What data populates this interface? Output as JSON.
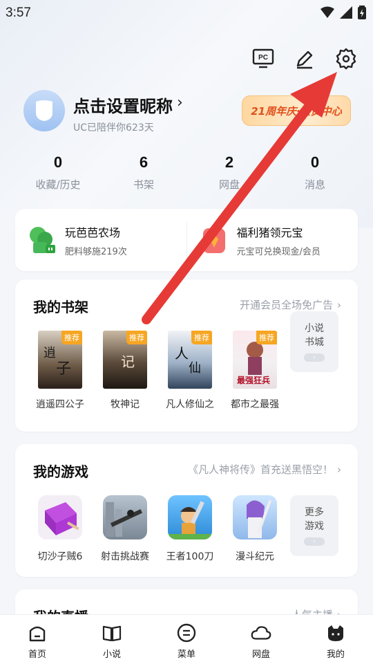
{
  "status": {
    "time": "3:57"
  },
  "profile": {
    "nickname": "点击设置昵称",
    "subline": "UC已陪伴你623天",
    "anniversary": "21周年庆·会员中心"
  },
  "stats": [
    {
      "value": "0",
      "label": "收藏/历史"
    },
    {
      "value": "6",
      "label": "书架"
    },
    {
      "value": "2",
      "label": "网盘"
    },
    {
      "value": "0",
      "label": "消息"
    }
  ],
  "promos": [
    {
      "title": "玩芭芭农场",
      "sub": "肥料够施219次",
      "icon": "farm-tree-icon"
    },
    {
      "title": "福利猪领元宝",
      "sub": "元宝可兑换现金/会员",
      "icon": "lucky-pig-icon"
    }
  ],
  "shelf": {
    "title": "我的书架",
    "link": "开通会员全场免广告",
    "badge": "推荐",
    "books": [
      {
        "title": "逍遥四公子"
      },
      {
        "title": "牧神记"
      },
      {
        "title": "凡人修仙之"
      },
      {
        "title": "都市之最强"
      }
    ],
    "more": {
      "line1": "小说",
      "line2": "书城"
    }
  },
  "games": {
    "title": "我的游戏",
    "link": "《凡人神将传》首充送黑悟空！",
    "items": [
      {
        "title": "切沙子贼6"
      },
      {
        "title": "射击挑战赛"
      },
      {
        "title": "王者100刀"
      },
      {
        "title": "漫斗纪元"
      }
    ],
    "more": {
      "line1": "更多",
      "line2": "游戏"
    }
  },
  "live": {
    "title": "我的直播",
    "link": "人气主播"
  },
  "nav": [
    {
      "label": "首页",
      "icon": "home-icon"
    },
    {
      "label": "小说",
      "icon": "book-icon"
    },
    {
      "label": "菜单",
      "icon": "menu-icon"
    },
    {
      "label": "网盘",
      "icon": "cloud-icon"
    },
    {
      "label": "我的",
      "icon": "profile-cat-icon"
    }
  ],
  "colors": {
    "arrow": "#e63a36",
    "badge": "#f6a623",
    "anniversary_text": "#e0501c"
  }
}
